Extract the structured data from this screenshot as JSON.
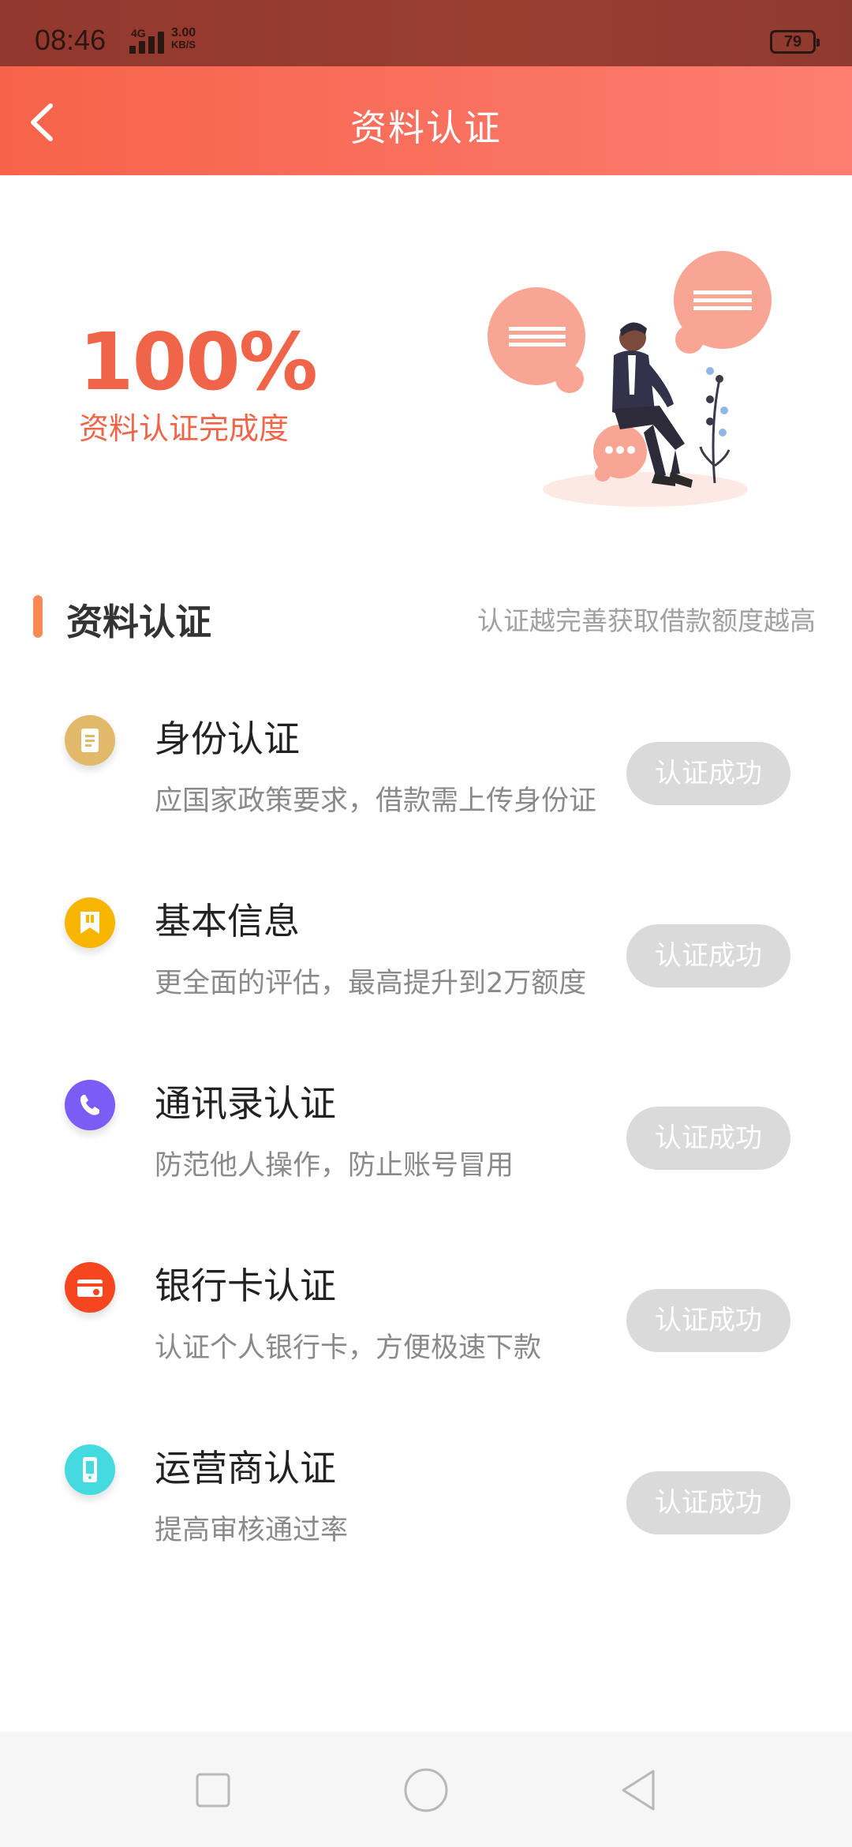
{
  "status_bar": {
    "time": "08:46",
    "network": "4G",
    "speed_value": "3.00",
    "speed_unit": "KB/S",
    "battery": "79"
  },
  "header": {
    "title": "资料认证",
    "back_icon": "chevron-left-icon"
  },
  "hero": {
    "percent": "100%",
    "label": "资料认证完成度",
    "illustration": "person-with-chat-bubbles-illustration"
  },
  "section": {
    "title": "资料认证",
    "subtitle": "认证越完善获取借款额度越高",
    "accent_color": "#ff8a55"
  },
  "items": [
    {
      "title": "身份认证",
      "desc": "应国家政策要求，借款需上传身份证",
      "status": "认证成功",
      "icon": "id-card-icon",
      "icon_color": "#e2b86a"
    },
    {
      "title": "基本信息",
      "desc": "更全面的评估，最高提升到2万额度",
      "status": "认证成功",
      "icon": "bookmark-icon",
      "icon_color": "#f7b500"
    },
    {
      "title": "通讯录认证",
      "desc": "防范他人操作，防止账号冒用",
      "status": "认证成功",
      "icon": "phone-icon",
      "icon_color": "#7b5cf5"
    },
    {
      "title": "银行卡认证",
      "desc": "认证个人银行卡，方便极速下款",
      "status": "认证成功",
      "icon": "bank-card-icon",
      "icon_color": "#f5461f"
    },
    {
      "title": "运营商认证",
      "desc": "提高审核通过率",
      "status": "认证成功",
      "icon": "mobile-icon",
      "icon_color": "#45d9e0"
    }
  ],
  "nav_bar": {
    "recents_icon": "square-icon",
    "home_icon": "circle-icon",
    "back_icon": "triangle-back-icon"
  },
  "colors": {
    "brand": "#f7634a",
    "hero_text": "#f06549",
    "status_pill": "#dadada"
  }
}
